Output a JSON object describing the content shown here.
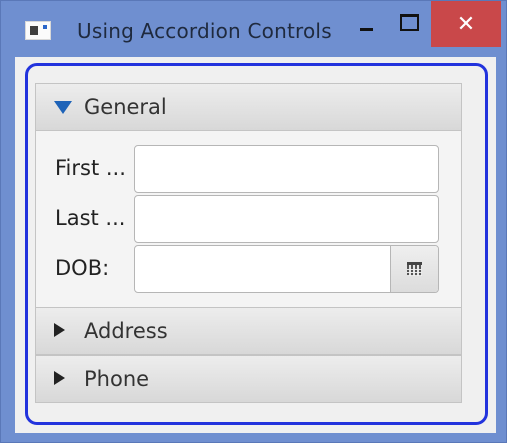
{
  "window": {
    "title": "Using Accordion Controls",
    "close_glyph": "✕",
    "icons": [
      "app-icon",
      "minimize-icon",
      "maximize-icon",
      "close-icon"
    ]
  },
  "accordion": {
    "panes": [
      {
        "title": "General",
        "expanded": true,
        "fields": [
          {
            "label": "First ...",
            "value": "",
            "type": "text"
          },
          {
            "label": "Last ...",
            "value": "",
            "type": "text"
          },
          {
            "label": "DOB:",
            "value": "",
            "type": "date",
            "icon": "calendar-icon"
          }
        ]
      },
      {
        "title": "Address",
        "expanded": false
      },
      {
        "title": "Phone",
        "expanded": false
      }
    ]
  },
  "colors": {
    "titlebar": "#6f8fd0",
    "close_button": "#c9484a",
    "focus_ring": "#2233dd",
    "expanded_arrow": "#1e63b8"
  }
}
